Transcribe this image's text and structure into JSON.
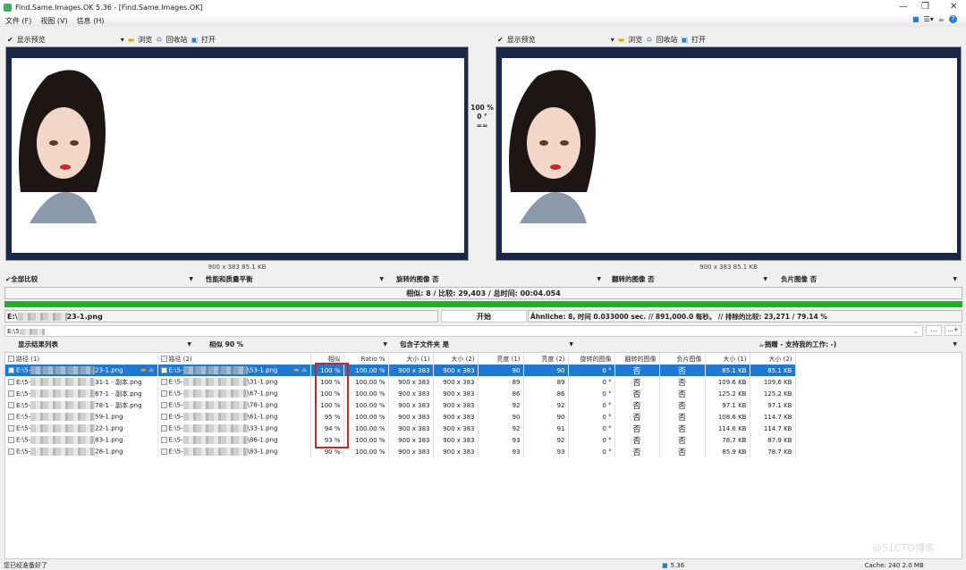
{
  "window": {
    "title": "Find.Same.Images.OK 5.36 - [Find.Same.Images.OK]",
    "minimize": "—",
    "maximize": "❐",
    "close": "✕"
  },
  "menu": [
    "文件 (F)",
    "视图 (V)",
    "信息 (H)"
  ],
  "preview_toolbar": {
    "show_preview": "显示预览",
    "browse": "浏览",
    "recycle": "回收站",
    "open": "打开"
  },
  "left_preview": {
    "caption": "900 x 383 85.1 KB"
  },
  "right_preview": {
    "caption": "900 x 383 85.1 KB"
  },
  "compare_info": {
    "similarity": "100 %",
    "rotation": "0 °",
    "equal": "=="
  },
  "options": {
    "compare_all": "全部比较",
    "performance": "性能和质量平衡",
    "rotated": "旋转的图像 否",
    "flipped": "翻转的图像 否",
    "negative": "负片图像 否"
  },
  "summary": "相似: 8 / 比较: 29,403 / 总时间: 00:04.054",
  "progress": 1.0,
  "current_file": "E:\\",
  "current_file_tail": "23-1.png",
  "start_button": "开始",
  "stats": "Ähnliche: 8, 时间 0.033000 sec. // 891,000.0 每秒。 // 排除的比较: 23,271 / 79.14 %",
  "folder_input": "E:\\5",
  "folder_buttons": [
    "...",
    "...+"
  ],
  "filters": {
    "show_list": "显示结果列表",
    "similar": "相似 90 %",
    "subfolders": "包含子文件夹 是",
    "donate": "捐赠 - 支持我的工作: -)"
  },
  "table": {
    "headers": [
      "路径 (1)",
      "路径 (2)",
      "相似",
      "Ratio %",
      "大小 (1)",
      "大小 (2)",
      "亮度 (1)",
      "亮度 (2)",
      "旋转的图像",
      "翻转的图像",
      "负片图像",
      "大小 (1)",
      "大小 (2)"
    ],
    "rows": [
      [
        "E:\\5-",
        "23-1.png",
        "E:\\5-",
        "\\53-1.png",
        "100 %",
        "100.00 %",
        "900 x 383",
        "900 x 383",
        "90",
        "90",
        "0 °",
        "否",
        "否",
        "85.1 KB",
        "85.1 KB"
      ],
      [
        "E:\\5-",
        "31-1 - 副本.png",
        "E:\\5-",
        "\\31-1.png",
        "100 %",
        "100.00 %",
        "900 x 383",
        "900 x 383",
        "89",
        "89",
        "0 °",
        "否",
        "否",
        "109.6 KB",
        "109.6 KB"
      ],
      [
        "E:\\5-",
        "67-1 - 副本.png",
        "E:\\5-",
        "\\67-1.png",
        "100 %",
        "100.00 %",
        "900 x 383",
        "900 x 383",
        "86",
        "86",
        "0 °",
        "否",
        "否",
        "125.2 KB",
        "125.2 KB"
      ],
      [
        "E:\\5-",
        "78-1 - 副本.png",
        "E:\\5-",
        "\\78-1.png",
        "100 %",
        "100.00 %",
        "900 x 383",
        "900 x 383",
        "92",
        "92",
        "0 °",
        "否",
        "否",
        "97.1 KB",
        "97.1 KB"
      ],
      [
        "E:\\5-",
        "59-1.png",
        "E:\\5-",
        "\\61-1.png",
        "95 %",
        "100.00 %",
        "900 x 383",
        "900 x 383",
        "90",
        "90",
        "0 °",
        "否",
        "否",
        "108.6 KB",
        "114.7 KB"
      ],
      [
        "E:\\5-",
        "22-1.png",
        "E:\\5-",
        "\\33-1.png",
        "94 %",
        "100.00 %",
        "900 x 383",
        "900 x 383",
        "92",
        "91",
        "0 °",
        "否",
        "否",
        "114.6 KB",
        "114.7 KB"
      ],
      [
        "E:\\5-",
        "83-1.png",
        "E:\\5-",
        "\\86-1.png",
        "93 %",
        "100.00 %",
        "900 x 383",
        "900 x 383",
        "93",
        "92",
        "0 °",
        "否",
        "否",
        "78.7 KB",
        "87.9 KB"
      ],
      [
        "E:\\5-",
        "28-1.png",
        "E:\\5-",
        "\\83-1.png",
        "90 %",
        "100.00 %",
        "900 x 383",
        "900 x 383",
        "93",
        "93",
        "0 °",
        "否",
        "否",
        "85.9 KB",
        "78.7 KB"
      ]
    ]
  },
  "statusbar": {
    "left": "您已经准备好了",
    "version": "5.36",
    "cache": "Cache: 240 2.0 MB"
  },
  "watermark": "@51CTO博客",
  "colors": {
    "progress": "#22b02a",
    "selection": "#1e78d4",
    "highlight": "#cc2222",
    "pane": "#1c2647"
  }
}
